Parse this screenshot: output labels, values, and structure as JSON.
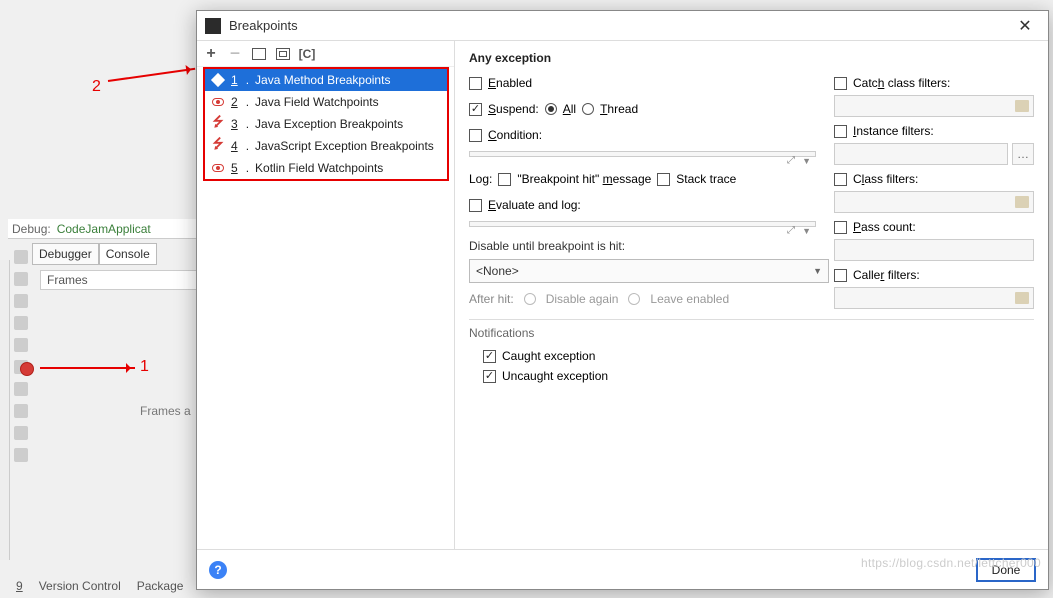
{
  "bg": {
    "debug_label": "Debug:",
    "app_run": "CodeJamApplicat",
    "tab_debugger": "Debugger",
    "tab_console": "Console",
    "frames_label": "Frames",
    "frames_empty": "Frames a",
    "bottom_vcs_num": "9",
    "bottom_vcs": "Version Control",
    "bottom_packages": "Package"
  },
  "annotations": {
    "num1": "1",
    "num2": "2"
  },
  "dialog": {
    "title": "Breakpoints",
    "close": "✕",
    "menu": [
      {
        "num": "1",
        "label": "Java Method Breakpoints",
        "icon": "rhombus"
      },
      {
        "num": "2",
        "label": "Java Field Watchpoints",
        "icon": "eye"
      },
      {
        "num": "3",
        "label": "Java Exception Breakpoints",
        "icon": "bolt"
      },
      {
        "num": "4",
        "label": "JavaScript Exception Breakpoints",
        "icon": "bolt"
      },
      {
        "num": "5",
        "label": "Kotlin Field Watchpoints",
        "icon": "eye"
      }
    ],
    "right": {
      "header": "Any exception",
      "enabled_label": "Enabled",
      "suspend_label": "Suspend:",
      "suspend_all": "All",
      "suspend_thread": "Thread",
      "condition_label": "Condition:",
      "log_label": "Log:",
      "log_bp_hit": "\"Breakpoint hit\" message",
      "log_stack": "Stack trace",
      "eval_label": "Evaluate and log:",
      "disable_until": "Disable until breakpoint is hit:",
      "disable_value": "<None>",
      "after_hit": "After hit:",
      "after_disable": "Disable again",
      "after_leave": "Leave enabled",
      "catch_filters": "Catch class filters:",
      "instance_filters": "Instance filters:",
      "class_filters": "Class filters:",
      "pass_count": "Pass count:",
      "caller_filters": "Caller filters:",
      "notifications": "Notifications",
      "caught": "Caught exception",
      "uncaught": "Uncaught exception",
      "done": "Done",
      "help": "?"
    }
  },
  "watermark": "https://blog.csdn.net/lettcher000"
}
